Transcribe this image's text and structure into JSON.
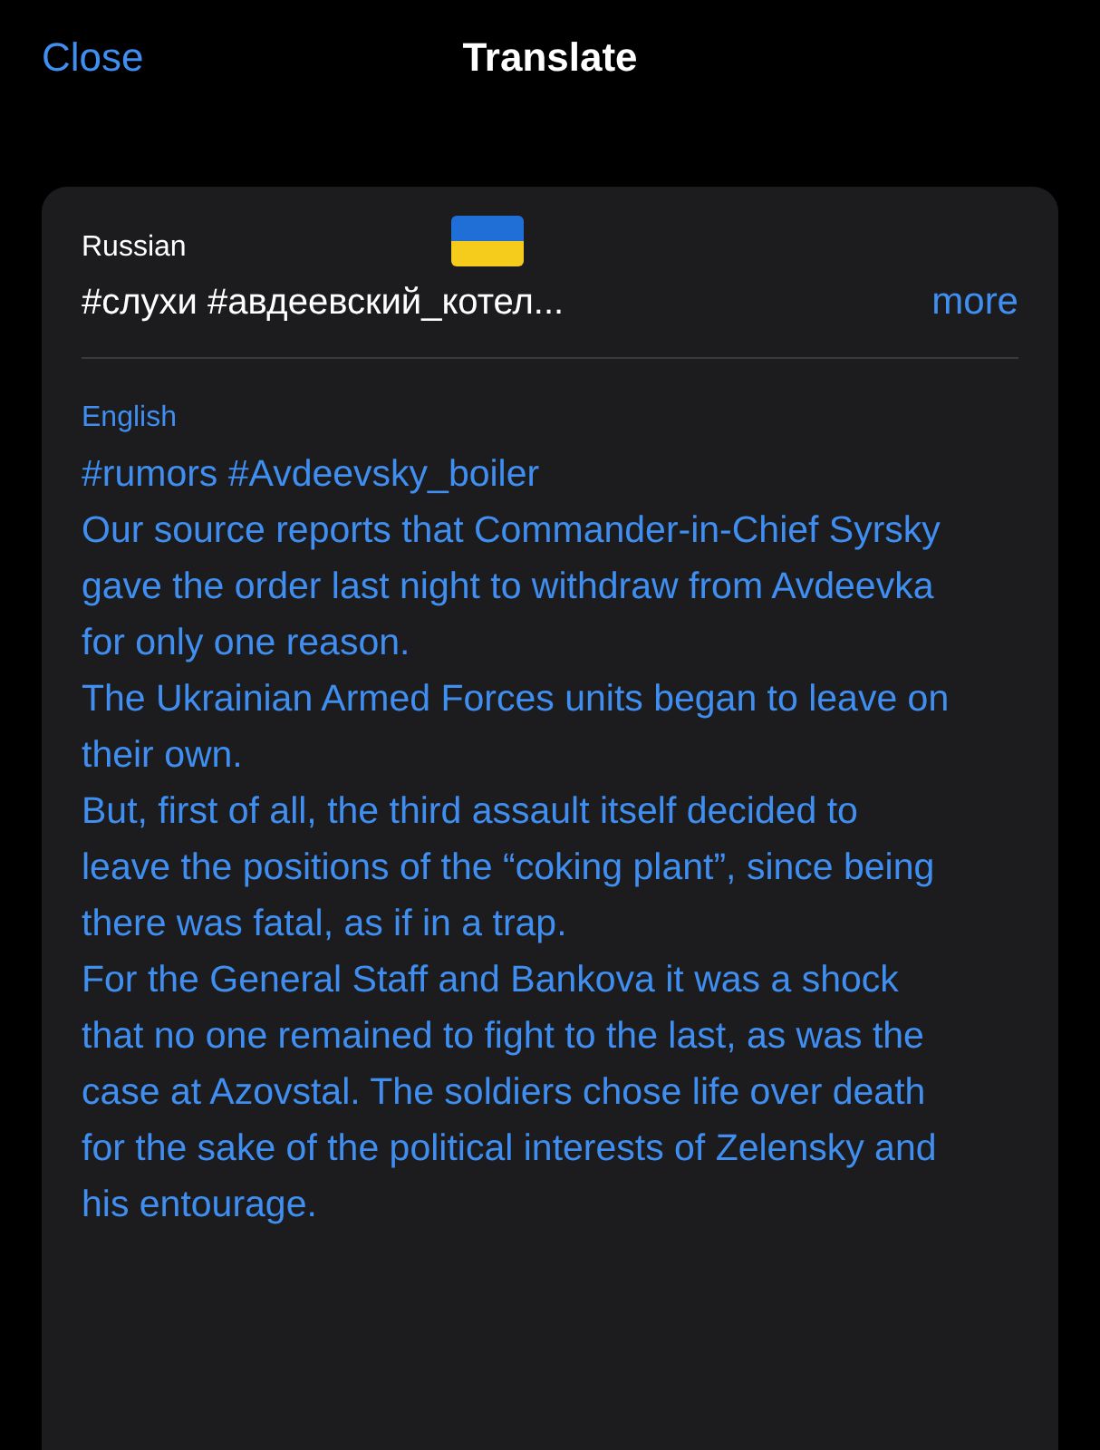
{
  "header": {
    "close": "Close",
    "title": "Translate"
  },
  "source": {
    "language": "Russian",
    "text": "#слухи #авдеевский_котел...",
    "more": "more"
  },
  "translation": {
    "language": "English",
    "paragraphs": [
      "#rumors #Avdeevsky_boiler",
      "Our source reports that Commander-in-Chief Syrsky gave the order last night to withdraw from Avdeevka for only one reason.",
      "The Ukrainian Armed Forces units began to leave on their own.",
      "But, first of all, the third assault itself decided to leave the positions of the “coking plant”, since being there was fatal, as if in a trap.",
      "For the General Staff and Bankova it was a shock that no one remained to fight to the last, as was the case at Azovstal. The soldiers chose life over death for the sake of the political interests of Zelensky and his entourage."
    ]
  }
}
